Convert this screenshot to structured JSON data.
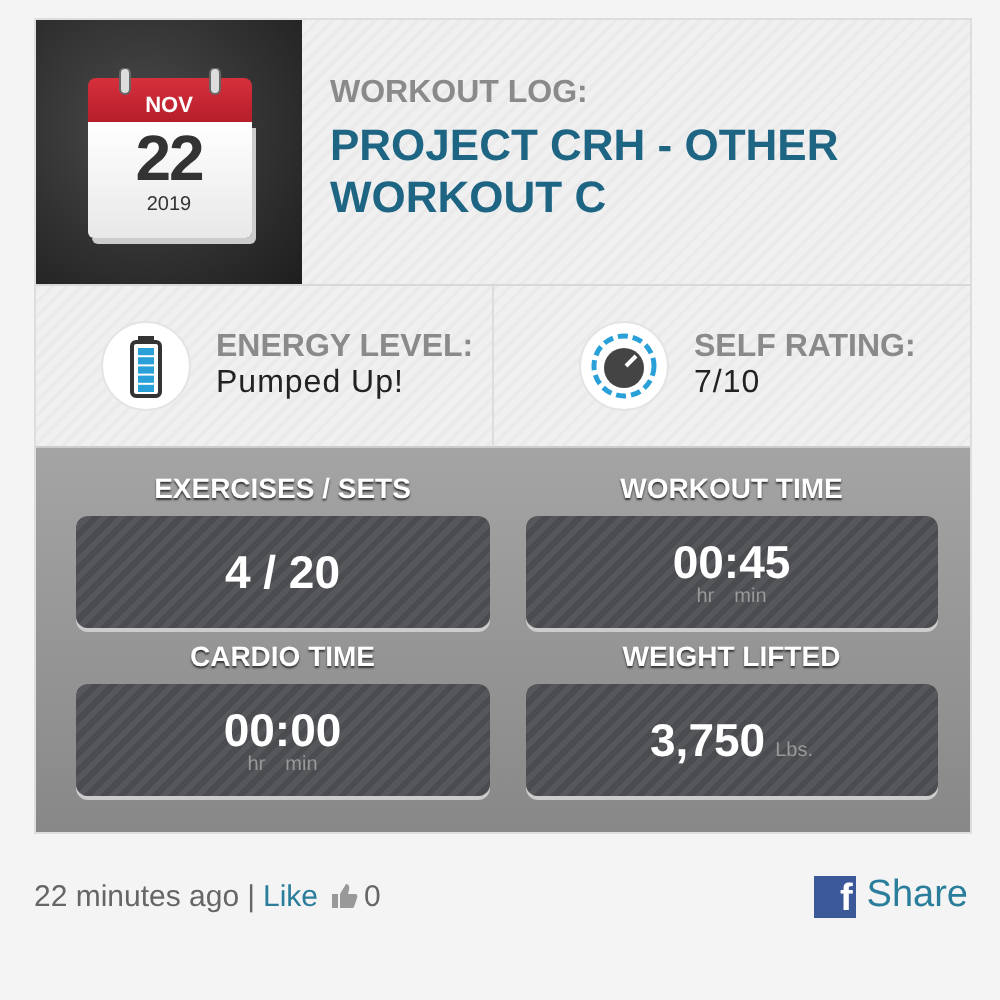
{
  "calendar": {
    "month": "NOV",
    "day": "22",
    "year": "2019"
  },
  "header": {
    "kicker": "WORKOUT LOG:",
    "title": "PROJECT CRH - OTHER WORKOUT C"
  },
  "info": [
    {
      "kind": "battery",
      "label": "ENERGY LEVEL:",
      "value": "Pumped Up!"
    },
    {
      "kind": "dial",
      "label": "SELF RATING:",
      "value": "7/10"
    }
  ],
  "stats": [
    {
      "label": "EXERCISES / SETS",
      "value": "4 / 20"
    },
    {
      "label": "WORKOUT TIME",
      "value": "00:45",
      "units": [
        "hr",
        "min"
      ]
    },
    {
      "label": "CARDIO TIME",
      "value": "00:00",
      "units": [
        "hr",
        "min"
      ]
    },
    {
      "label": "WEIGHT LIFTED",
      "value": "3,750",
      "suffix": "Lbs."
    }
  ],
  "footer": {
    "time": "22 minutes ago",
    "separator": "|",
    "like": "Like",
    "likes": "0",
    "share_icon": "f",
    "share": "Share"
  }
}
